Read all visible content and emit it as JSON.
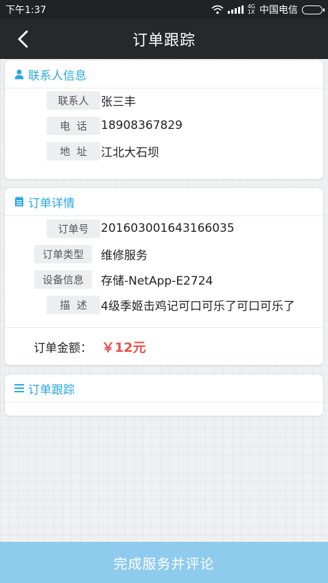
{
  "status_bar": {
    "time": "下午1:37",
    "network": "4G",
    "network_sub": "1X",
    "carrier": "中国电信"
  },
  "nav": {
    "title": "订单跟踪"
  },
  "contact": {
    "header": "联系人信息",
    "rows": [
      {
        "label": "联系人",
        "value": "张三丰"
      },
      {
        "label": "电  话",
        "value": "18908367829"
      },
      {
        "label": "地  址",
        "value": "江北大石坝"
      }
    ]
  },
  "order": {
    "header": "订单详情",
    "rows": [
      {
        "label": "订单号",
        "value": "201603001643166035"
      },
      {
        "label": "订单类型",
        "value": "维修服务"
      },
      {
        "label": "设备信息",
        "value": "存储-NetApp-E2724"
      },
      {
        "label": "描  述",
        "value": "4级季姬击鸡记可口可乐了可口可乐了"
      }
    ],
    "amount_label": "订单金额：",
    "amount_value": "￥12元"
  },
  "tracking": {
    "header": "订单跟踪"
  },
  "bottom_button": {
    "label": "完成服务并评论"
  },
  "colors": {
    "accent": "#2aa7e0",
    "amount": "#e8514d",
    "button": "#8ecbec",
    "navbar": "#25292c"
  }
}
